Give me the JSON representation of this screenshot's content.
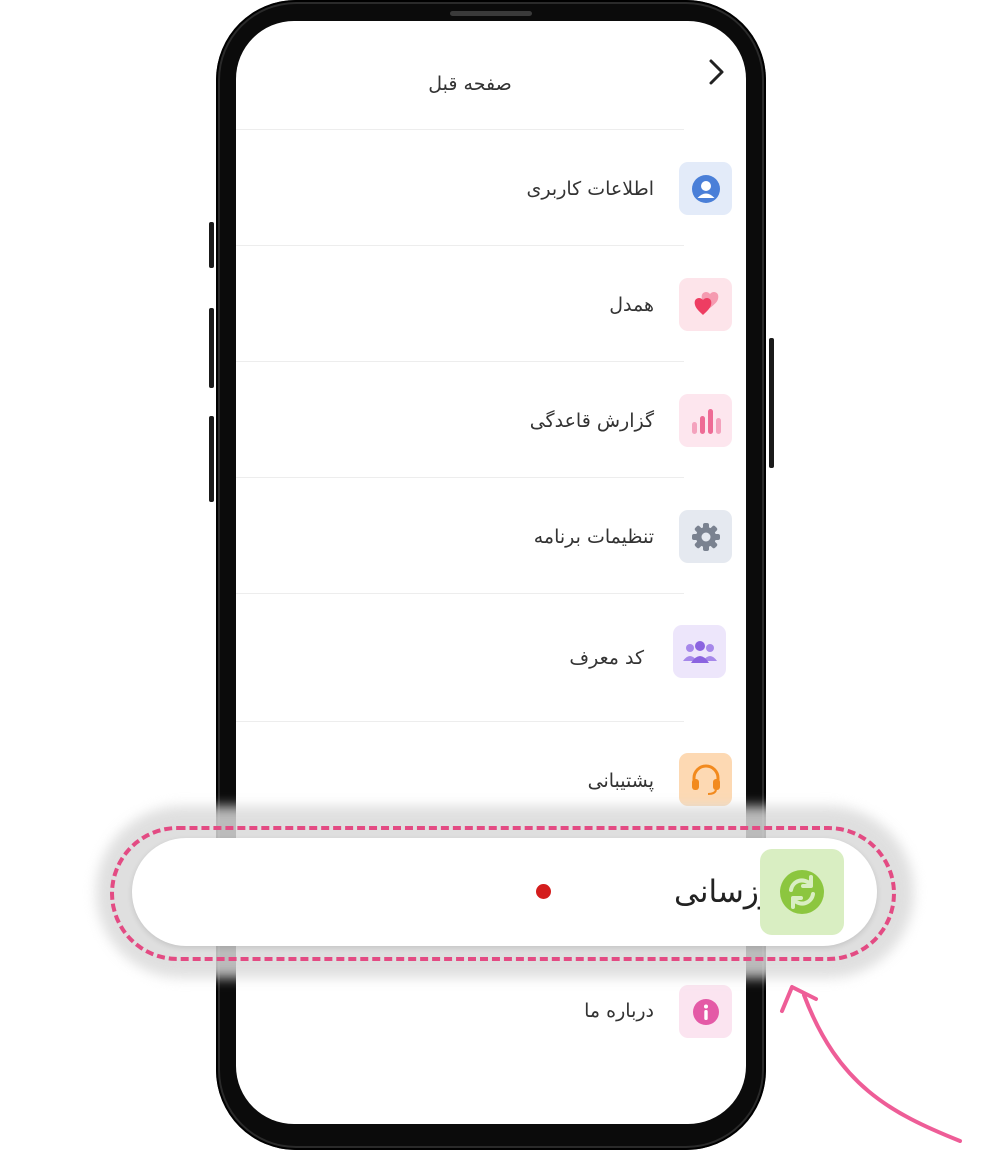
{
  "header": {
    "title": "صفحه قبل",
    "back_icon": "chevron-right-icon"
  },
  "menu": {
    "items": [
      {
        "label": "اطلاعات کاربری",
        "icon": "user-icon",
        "icon_bg": "#e3ebf9",
        "icon_color": "#4a7fd8"
      },
      {
        "label": "همدل",
        "icon": "hearts-icon",
        "icon_bg": "#fde4ea",
        "icon_color": "#ee3d62"
      },
      {
        "label": "گزارش قاعدگی",
        "icon": "bar-chart-icon",
        "icon_bg": "#fde6ee",
        "icon_color": "#ee6b95"
      },
      {
        "label": "تنظیمات برنامه",
        "icon": "gear-icon",
        "icon_bg": "#e5e9f0",
        "icon_color": "#7a8290"
      },
      {
        "label": "کد معرف",
        "icon": "group-icon",
        "icon_bg": "#ede6fb",
        "icon_color": "#8b63e0"
      },
      {
        "label": "پشتیبانی",
        "icon": "headset-icon",
        "icon_bg": "#fdd9b3",
        "icon_color": "#f28a1e"
      },
      {
        "label": "درباره ما",
        "icon": "info-icon",
        "icon_bg": "#fbe4f0",
        "icon_color": "#e45aa6"
      }
    ]
  },
  "highlight": {
    "label": "بەڕوزسانی",
    "icon": "refresh-icon",
    "icon_bg": "#d9eec2",
    "icon_color": "#8cc63f",
    "dot_color": "#d41d1d"
  },
  "annotation": {
    "ring_color": "#e34b83",
    "arrow_color": "#ee5d97"
  }
}
